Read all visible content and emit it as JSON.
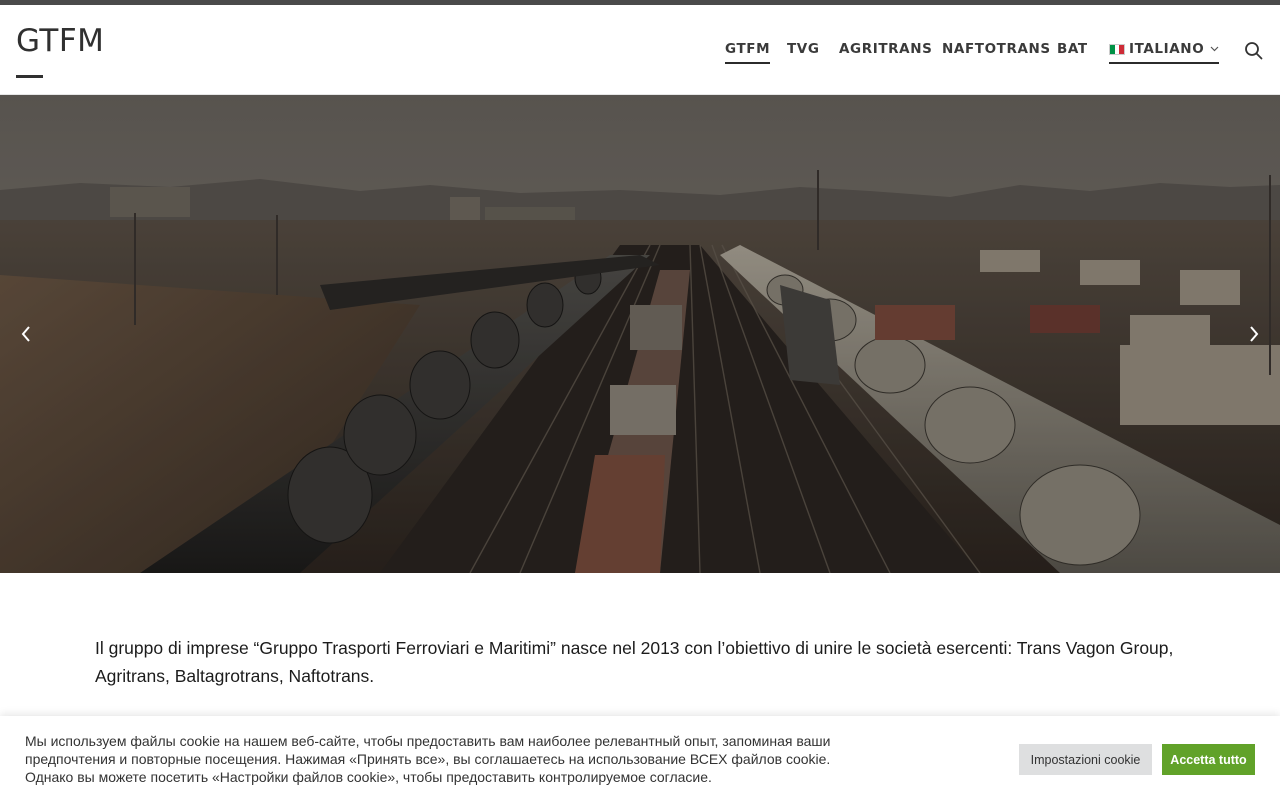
{
  "site": {
    "logo": "GTFM"
  },
  "nav": {
    "items": [
      {
        "label": "GTFM",
        "active": true
      },
      {
        "label": "TVG"
      },
      {
        "label": "AGRITRANS"
      },
      {
        "label": "NAFTOTRANS"
      },
      {
        "label": "BAT"
      }
    ],
    "language": {
      "label": "ITALIANO",
      "flag": "flag-italy-icon"
    },
    "search_icon": "search-icon"
  },
  "hero": {
    "prev_icon": "chevron-left-icon",
    "next_icon": "chevron-right-icon"
  },
  "content": {
    "intro": "Il gruppo di imprese “Gruppo Trasporti Ferroviari e Maritimi” nasce nel 2013 con l’obiettivo di unire le società esercenti: Trans Vagon Group, Agritrans, Baltagrotrans, Naftotrans."
  },
  "cookie": {
    "text_line1": "Мы используем файлы cookie на нашем веб-сайте, чтобы предоставить вам наиболее релевантный опыт, запоминая ваши",
    "text_line2": "предпочтения и повторные посещения. Нажимая «Принять все», вы соглашаетесь на использование ВСЕХ файлов cookie.",
    "text_line3": "Однако вы можете посетить «Настройки файлов cookie», чтобы предоставить контролируемое согласие.",
    "settings_label": "Impostazioni cookie",
    "accept_label": "Accetta tutto"
  },
  "colors": {
    "accent_green": "#61a229",
    "top_bar": "#4a4a4a",
    "text_dark": "#303030"
  }
}
